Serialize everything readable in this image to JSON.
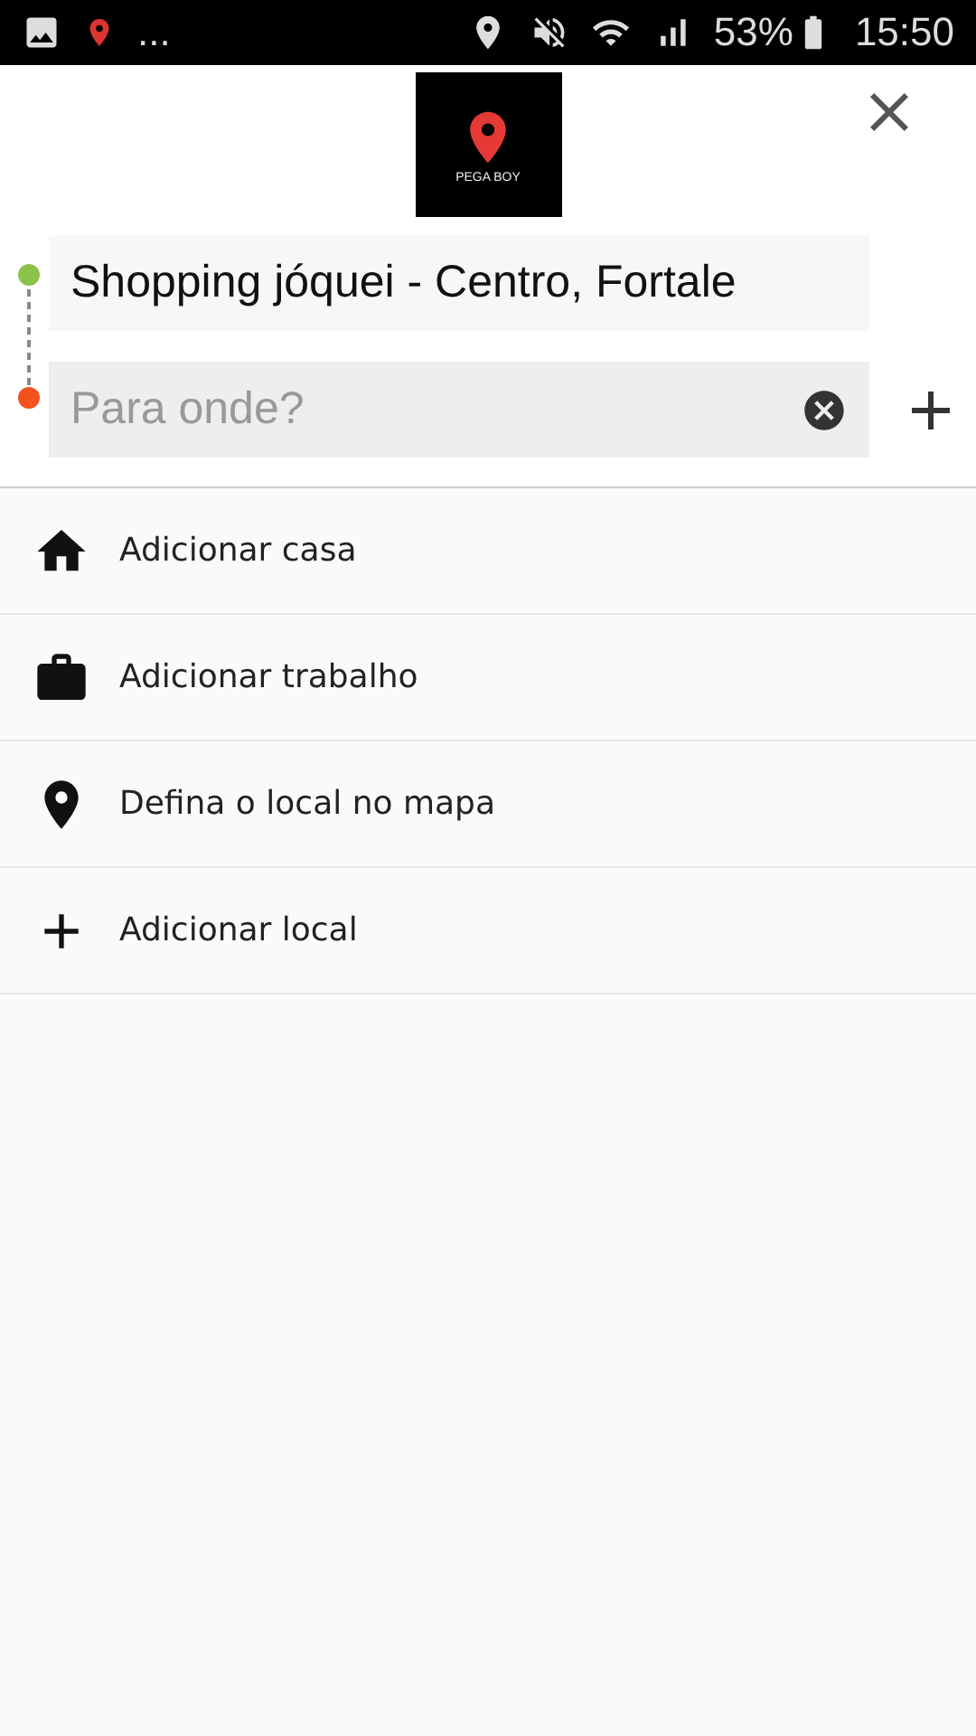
{
  "status_bar": {
    "more": "...",
    "battery": "53%",
    "time": "15:50"
  },
  "logo": {
    "name": "PEGA BOY"
  },
  "origin": {
    "value": "Shopping jóquei - Centro, Fortale"
  },
  "destination": {
    "placeholder": "Para onde?"
  },
  "items": [
    {
      "kind": "home",
      "label": "Adicionar casa"
    },
    {
      "kind": "work",
      "label": "Adicionar trabalho"
    },
    {
      "kind": "pin",
      "label": "Defina o local no mapa"
    },
    {
      "kind": "add",
      "label": "Adicionar local"
    }
  ]
}
